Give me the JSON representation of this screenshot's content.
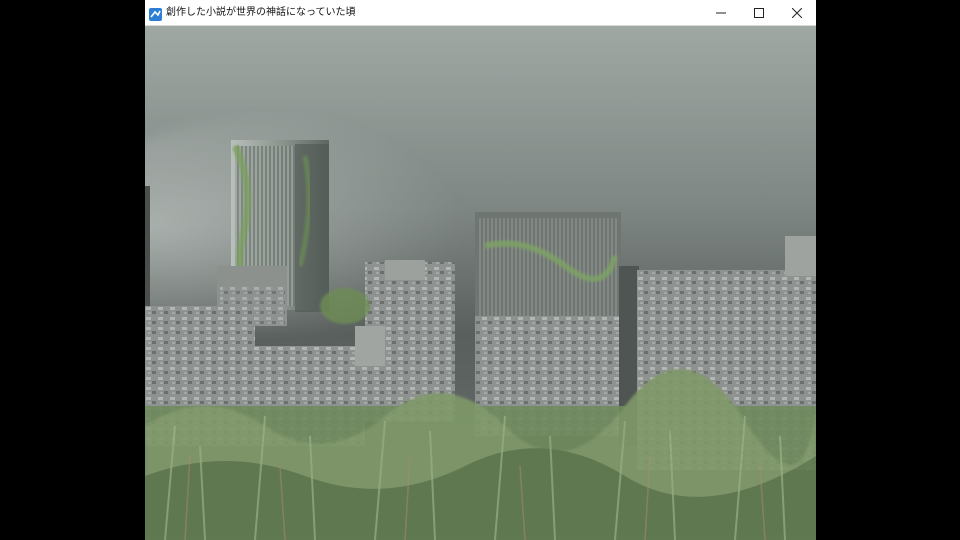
{
  "window": {
    "title": "創作した小説が世界の神話になっていた頃",
    "app_icon": "app-icon",
    "controls": {
      "minimize_icon": "minimize-icon",
      "maximize_icon": "maximize-icon",
      "close_icon": "close-icon"
    }
  },
  "scene": {
    "colors": {
      "sky_top": "#9aa39f",
      "sky_dark": "#4f5553",
      "vegetation": "#6f8c5a",
      "ruins": "#8a8f8c"
    }
  }
}
